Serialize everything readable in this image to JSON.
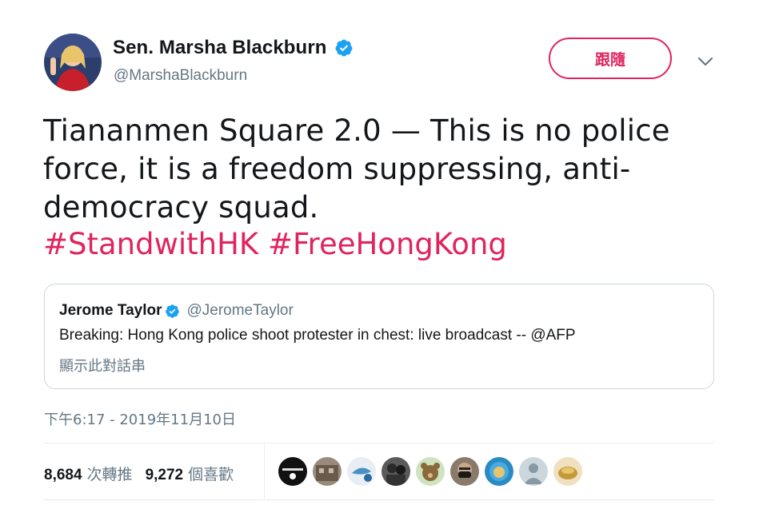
{
  "author": {
    "name": "Sen. Marsha Blackburn",
    "handle": "@MarshaBlackburn",
    "verified_icon": "verified-badge-icon"
  },
  "follow_button": {
    "label": "跟隨"
  },
  "more_menu": {
    "icon": "chevron-down-icon"
  },
  "tweet": {
    "text": "Tiananmen Square 2.0 — This is no police force, it is a freedom suppressing, anti-democracy squad.",
    "hashtags": [
      "#StandwithHK",
      "#FreeHongKong"
    ]
  },
  "quoted_tweet": {
    "name": "Jerome Taylor",
    "handle": "@JeromeTaylor",
    "text": "Breaking: Hong Kong police shoot protester in chest: live broadcast -- @AFP",
    "thread_link": "顯示此對話串"
  },
  "timestamp": "下午6:17 - 2019年11月10日",
  "stats": {
    "retweets": {
      "count": "8,684",
      "label": "次轉推"
    },
    "likes": {
      "count": "9,272",
      "label": "個喜歡"
    }
  },
  "colors": {
    "accent": "#e0245e",
    "verified": "#1da1f2",
    "secondary_text": "#657786",
    "border": "#ccd6dd"
  },
  "likers": [
    {
      "icon": "standwithhongkong-avatar",
      "color": "#111111"
    },
    {
      "icon": "building-avatar",
      "color": "#7a6a5c"
    },
    {
      "icon": "bird-avatar",
      "color": "#4a90c2"
    },
    {
      "icon": "people-avatar",
      "color": "#3a3a3a"
    },
    {
      "icon": "bear-avatar",
      "color": "#8a6a3a"
    },
    {
      "icon": "masked-face-avatar",
      "color": "#5a4a3a"
    },
    {
      "icon": "lion-avatar",
      "color": "#2a8ac2"
    },
    {
      "icon": "default-user-avatar",
      "color": "#aab8c2"
    },
    {
      "icon": "food-avatar",
      "color": "#c29a3a"
    }
  ]
}
